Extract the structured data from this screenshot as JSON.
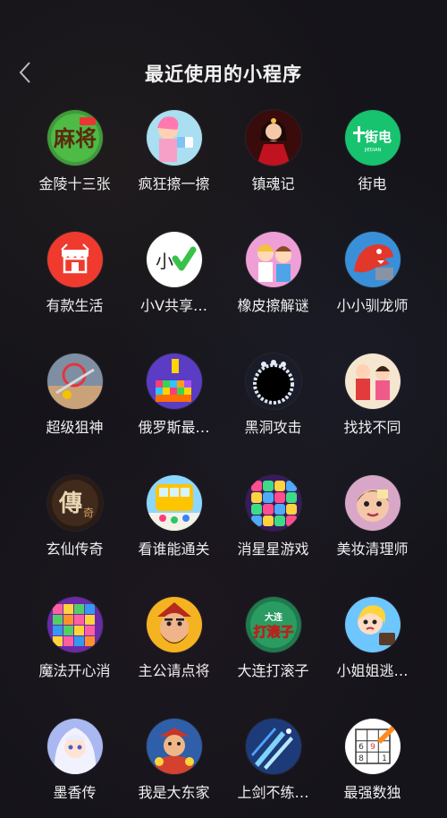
{
  "header": {
    "title": "最近使用的小程序",
    "back_icon": "chevron-left-icon"
  },
  "apps": [
    {
      "label": "金陵十三张",
      "icon": "mahjong-logo-icon"
    },
    {
      "label": "疯狂擦一擦",
      "icon": "eraser-girl-icon"
    },
    {
      "label": "镇魂记",
      "icon": "red-dress-woman-icon"
    },
    {
      "label": "街电",
      "icon": "jiedian-logo-icon"
    },
    {
      "label": "有款生活",
      "icon": "shop-awning-icon"
    },
    {
      "label": "小V共享…",
      "icon": "xiao-v-check-icon"
    },
    {
      "label": "橡皮擦解谜",
      "icon": "cartoon-couple-icon"
    },
    {
      "label": "小小驯龙师",
      "icon": "dragon-icon"
    },
    {
      "label": "超级狙神",
      "icon": "sniper-scene-icon"
    },
    {
      "label": "俄罗斯最…",
      "icon": "tetris-blocks-icon"
    },
    {
      "label": "黑洞攻击",
      "icon": "black-hole-icon"
    },
    {
      "label": "找找不同",
      "icon": "cartoon-characters-icon"
    },
    {
      "label": "玄仙传奇",
      "icon": "legend-calligraphy-icon"
    },
    {
      "label": "看谁能通关",
      "icon": "bus-runners-icon"
    },
    {
      "label": "消星星游戏",
      "icon": "star-blocks-icon"
    },
    {
      "label": "美妆清理师",
      "icon": "makeup-face-icon"
    },
    {
      "label": "魔法开心消",
      "icon": "magic-blocks-icon"
    },
    {
      "label": "主公请点将",
      "icon": "warrior-face-icon"
    },
    {
      "label": "大连打滚子",
      "icon": "dalian-card-logo-icon"
    },
    {
      "label": "小姐姐逃…",
      "icon": "escape-girl-icon"
    },
    {
      "label": "墨香传",
      "icon": "anime-girl-icon"
    },
    {
      "label": "我是大东家",
      "icon": "boss-man-icon"
    },
    {
      "label": "上剑不练…",
      "icon": "flying-swords-icon"
    },
    {
      "label": "最强数独",
      "icon": "sudoku-grid-icon"
    }
  ]
}
